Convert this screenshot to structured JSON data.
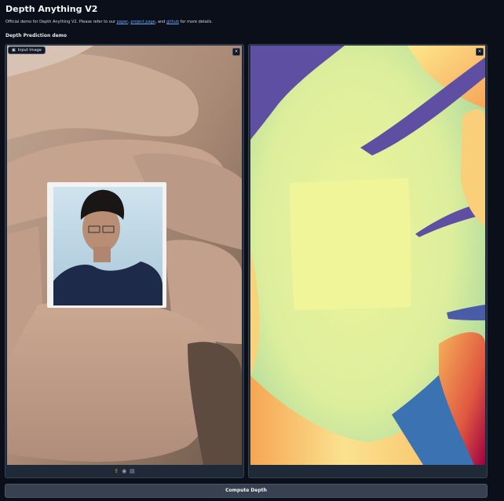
{
  "header": {
    "title": "Depth Anything V2",
    "description_prefix": "Official demo for Depth Anything V2. Please refer to our ",
    "link_paper": "paper",
    "sep1": ", ",
    "link_project": "project page",
    "sep2": ", and ",
    "link_github": "github",
    "description_suffix": " for more details.",
    "section_title": "Depth Prediction demo"
  },
  "input_panel": {
    "label": "Input Image",
    "close_icon": "×",
    "toolbar_icons": [
      "upload-icon",
      "webcam-icon",
      "clipboard-icon"
    ]
  },
  "output_panel": {
    "close_icon": "×"
  },
  "actions": {
    "compute_label": "Compute Depth"
  },
  "colors": {
    "background": "#0b0f19",
    "panel": "#1f2937",
    "link": "#60a5fa",
    "button": "#374151"
  }
}
